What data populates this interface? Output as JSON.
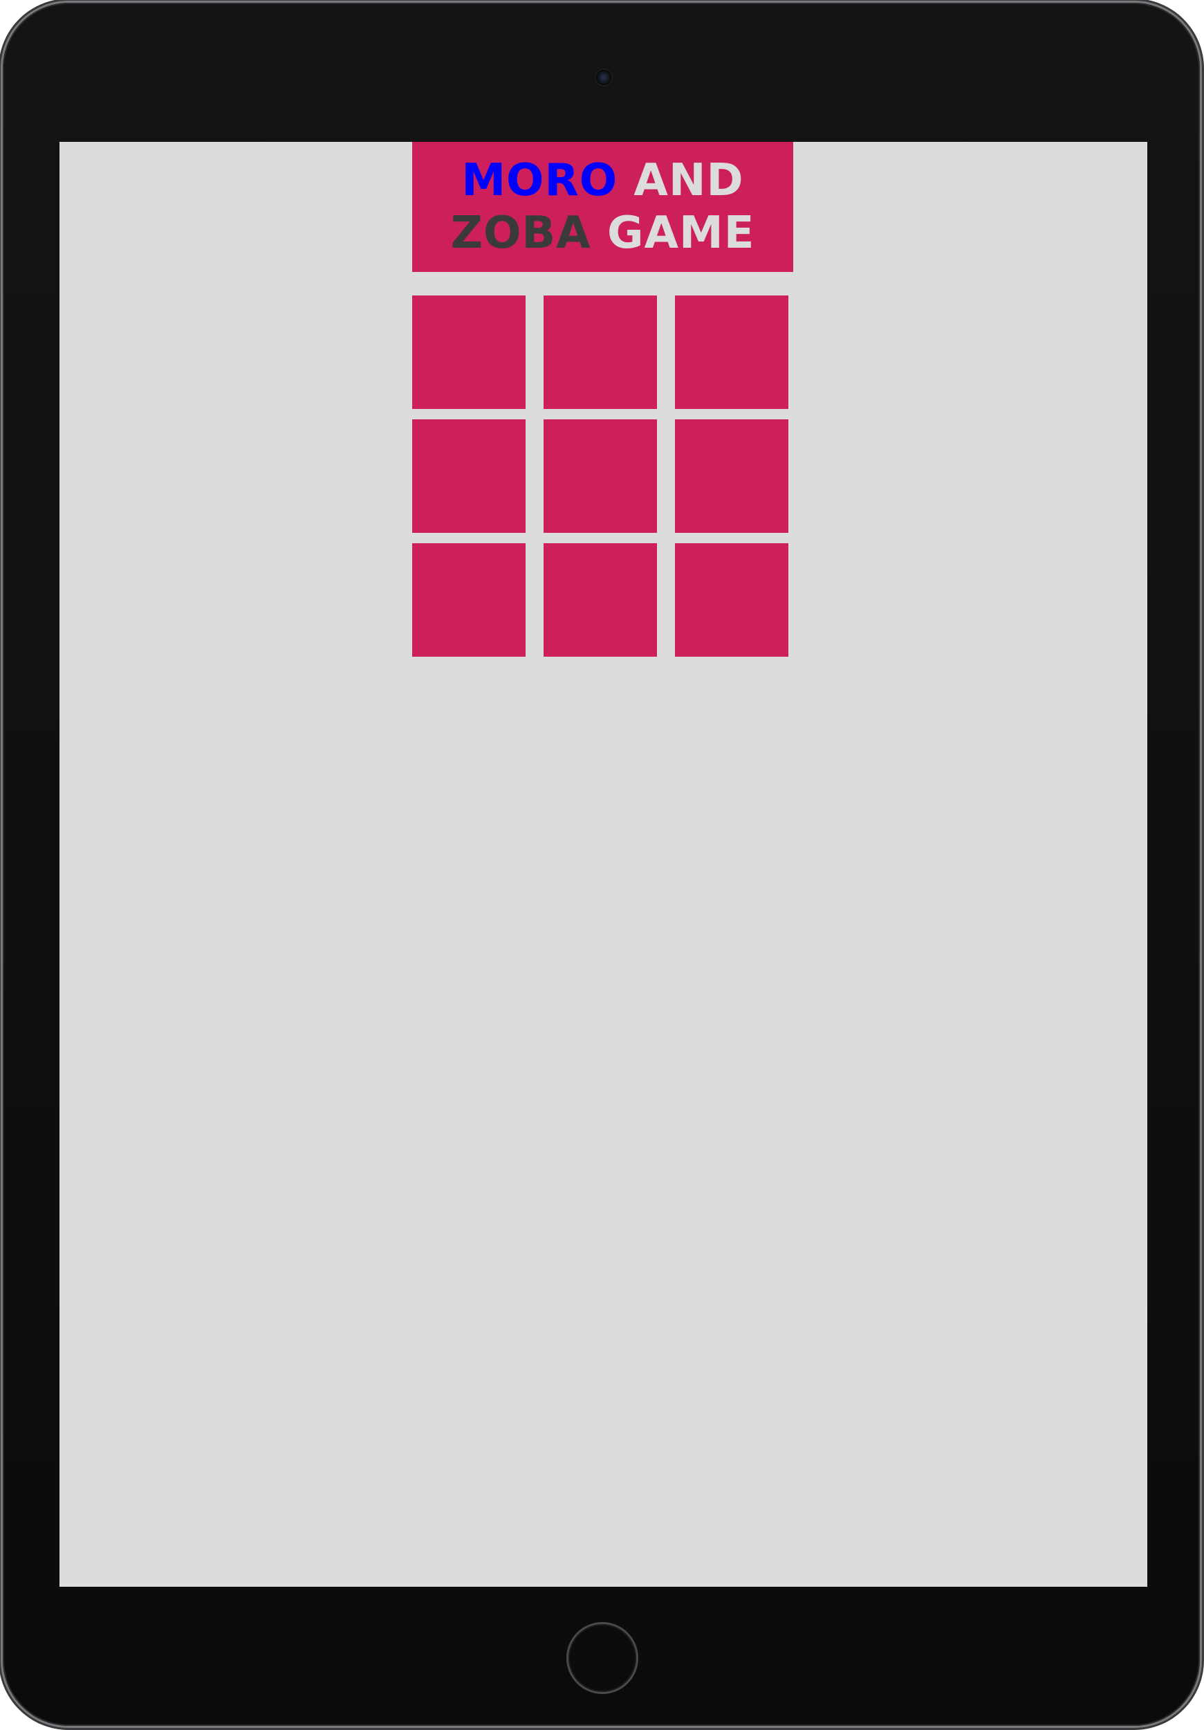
{
  "game": {
    "title": {
      "word1": "MORO",
      "word2": "AND",
      "word3": "ZOBA",
      "word4": "GAME"
    },
    "board": {
      "rows": 3,
      "columns": 3,
      "cells": [
        "",
        "",
        "",
        "",
        "",
        "",
        "",
        "",
        ""
      ]
    }
  },
  "colors": {
    "screen_background": "#dcdcdc",
    "tile": "#cd1f5c",
    "title_moro": "#0000ff",
    "title_zoba": "#3a3a3a",
    "title_plain": "#dcdcdc",
    "device_bezel": "#111111"
  },
  "device": {
    "camera_icon": "camera-icon",
    "home_button_icon": "home-button"
  }
}
